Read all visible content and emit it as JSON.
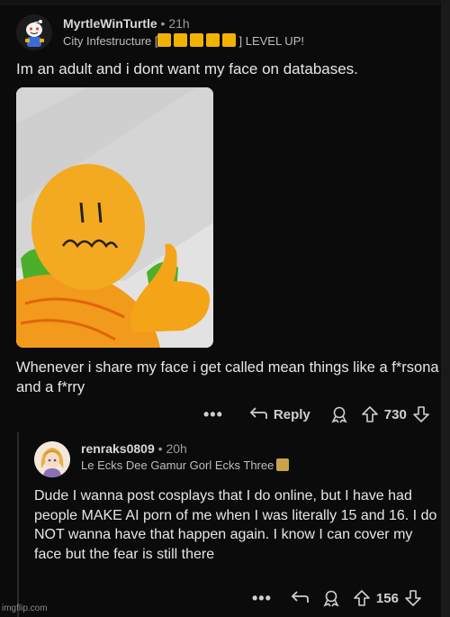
{
  "comment1": {
    "username": "MyrtleWinTurtle",
    "separator": "•",
    "time": "21h",
    "flair_prefix": "City Infestructure [",
    "flair_suffix": "] LEVEL UP!",
    "flair_box_count": 5,
    "flair_box_color": "#f2b200",
    "text_top": "Im an adult and i dont want my face on databases.",
    "text_bottom": "Whenever i share my face i get called mean things like a f*rsona and a f*rry",
    "actions": {
      "more": "•••",
      "reply_label": "Reply",
      "score": "730"
    }
  },
  "comment2": {
    "username": "renraks0809",
    "separator": "•",
    "time": "20h",
    "flair": "Le Ecks Dee Gamur Gorl Ecks Three",
    "text": "Dude I wanna post cosplays that I do online, but I have had people MAKE AI porn of me when I was literally 15 and 16. I do NOT wanna have that happen again. I know I can cover my face but the fear is still there",
    "actions": {
      "more": "•••",
      "score": "156"
    }
  },
  "watermark": "imgflip.com",
  "colors": {
    "background": "#0b0b0b",
    "text": "#e6e6e6",
    "muted": "#9a9a9a",
    "accent": "#f2b200"
  },
  "icons": [
    "snoo-avatar-icon",
    "reply-arrow-icon",
    "award-icon",
    "upvote-icon",
    "downvote-icon",
    "more-dots-icon"
  ]
}
